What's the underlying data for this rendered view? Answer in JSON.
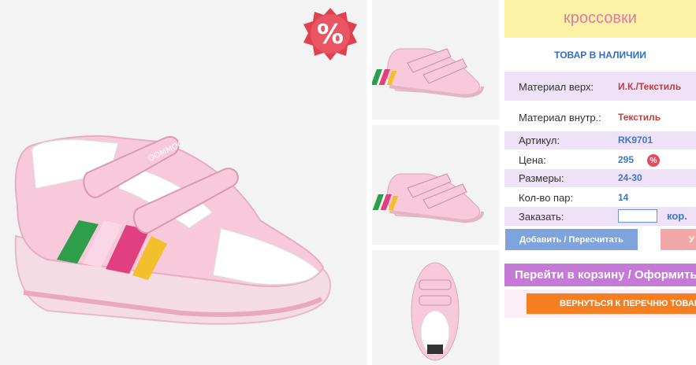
{
  "product": {
    "title": "кроссовки",
    "stock_status": "ТОВАР В НАЛИЧИИ",
    "discount_badge": "%",
    "image_alt": "pink children's sneakers with velcro straps and green, pink, yellow stripes"
  },
  "specs": [
    {
      "label": "Материал верх:",
      "value": "И.К./Текстиль"
    },
    {
      "label": "Материал внутр.:",
      "value": "Текстиль"
    },
    {
      "label": "Артикул:",
      "value": "RK9701"
    },
    {
      "label": "Цена:",
      "value": "295",
      "badge": "%"
    },
    {
      "label": "Размеры:",
      "value": "24-30"
    },
    {
      "label": "Кол-во пар:",
      "value": "14"
    }
  ],
  "order": {
    "label": "Заказать:",
    "quantity": "",
    "unit": "кор."
  },
  "buttons": {
    "add": "Добавить / Пересчитать",
    "delete": "У",
    "cart": "Перейти в корзину / Оформить заказ",
    "back": "ВЕРНУТЬСЯ К ПЕРЕЧНЮ ТОВАРОВ"
  },
  "colors": {
    "shoe_pink": "#f4c6d6",
    "stripe_green": "#2e9e4a",
    "stripe_magenta": "#e0407f",
    "stripe_yellow": "#f2c02a",
    "title_bg": "#fbf2a4",
    "title_text": "#e07aa8",
    "accent_blue": "#3c78c8",
    "accent_red": "#c53b3b",
    "cart_button": "#c57ad8",
    "back_button": "#f57f20"
  }
}
